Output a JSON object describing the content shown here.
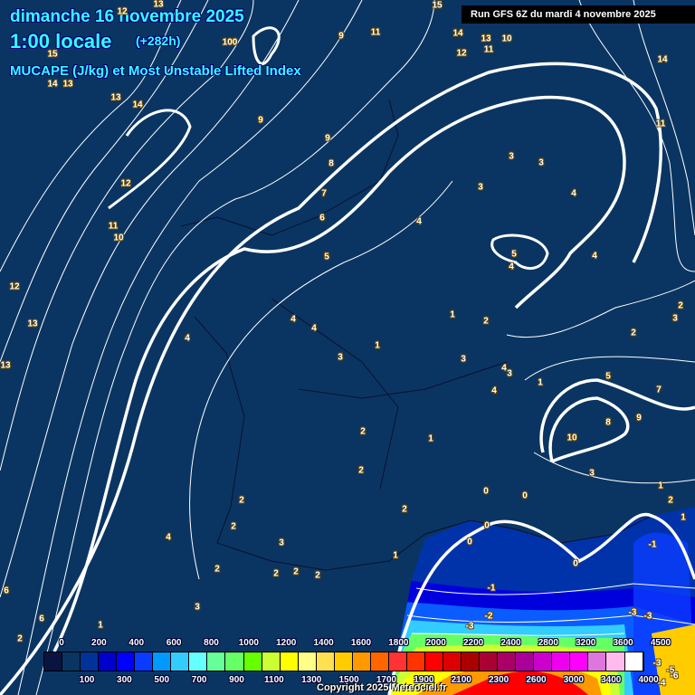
{
  "header": {
    "date": "dimanche 16 novembre 2025",
    "time": "1:00 locale",
    "lead": "(+282h)",
    "parameter": "MUCAPE (J/kg) et Most Unstable Lifted Index",
    "run": "Run GFS 6Z du mardi 4 novembre 2025"
  },
  "contour_labels": [
    "15",
    "12",
    "13",
    "9",
    "11",
    "14",
    "13",
    "10",
    "12",
    "11",
    "100",
    "15",
    "14",
    "13",
    "13",
    "14",
    "9",
    "9",
    "8",
    "7",
    "6",
    "5",
    "12",
    "11",
    "10",
    "12",
    "13",
    "13",
    "4",
    "4",
    "4",
    "3",
    "1",
    "1",
    "2",
    "3",
    "3",
    "3",
    "4",
    "4",
    "5",
    "4",
    "4",
    "14",
    "11",
    "2",
    "3",
    "2",
    "3",
    "4",
    "3",
    "4",
    "1",
    "5",
    "7",
    "8",
    "9",
    "10",
    "3",
    "1",
    "2",
    "1",
    "2",
    "1",
    "2",
    "0",
    "0",
    "2",
    "2",
    "2",
    "4",
    "3",
    "0",
    "0",
    "2",
    "2",
    "2",
    "2",
    "1",
    "-1",
    "0",
    "-1",
    "-2",
    "-3",
    "-3",
    "-3",
    "3",
    "6",
    "6",
    "2",
    "1",
    "-3",
    "-5",
    "-6",
    "-4"
  ],
  "legend": {
    "colors": [
      "#0a1440",
      "#0a3562",
      "#003399",
      "#0000cc",
      "#0000ff",
      "#0a3cff",
      "#0099ff",
      "#33ccff",
      "#66ffff",
      "#66ff99",
      "#66ff66",
      "#66ff00",
      "#ccff33",
      "#ffff00",
      "#ffff88",
      "#ffe050",
      "#ffcc00",
      "#ff9900",
      "#ff6600",
      "#ff3333",
      "#ff3300",
      "#ff0000",
      "#dd0000",
      "#aa0000",
      "#aa0033",
      "#aa0066",
      "#aa0099",
      "#cc00cc",
      "#ee00ee",
      "#ff00ff",
      "#dd77dd",
      "#ffbbee",
      "#ffffff"
    ],
    "top_labels": [
      "0",
      "200",
      "400",
      "600",
      "800",
      "1000",
      "1200",
      "1400",
      "1600",
      "1800",
      "2000",
      "2200",
      "2400",
      "2800",
      "3200",
      "3600",
      "4500"
    ],
    "bottom_labels": [
      "100",
      "300",
      "500",
      "700",
      "900",
      "1100",
      "1300",
      "1500",
      "1700",
      "1900",
      "2100",
      "2300",
      "2600",
      "3000",
      "3400",
      "4000"
    ]
  },
  "copyright": "Copyright 2025 Meteociel.fr"
}
